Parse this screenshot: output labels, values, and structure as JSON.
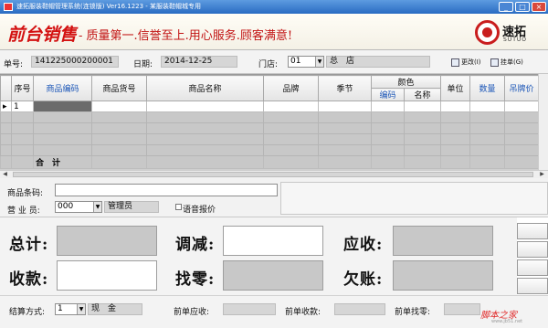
{
  "window": {
    "title": "速拓服装鞋帽管理系统(连锁版) Ver16.1223 - 某服装鞋帽城专用",
    "buttons": [
      "_",
      "□",
      "×"
    ]
  },
  "banner": {
    "brand": "前台销售",
    "slogan": "- 质量第一.信誉至上.用心服务.顾客满意!",
    "logo_cn": "速拓",
    "logo_en": "SUTUO",
    "logo_color": "#c91d1d"
  },
  "header": {
    "order_label": "单号:",
    "order_value": "141225000200001",
    "date_label": "日期:",
    "date_value": "2014-12-25",
    "store_label": "门店:",
    "store_code": "01",
    "store_name": "总　店",
    "tool1_label": "更改(I)",
    "tool2_label": "挂单(G)",
    "tool1_icon": "edit-icon",
    "tool2_icon": "hold-icon"
  },
  "grid": {
    "columns": [
      "序号",
      "商品编码",
      "商品货号",
      "商品名称",
      "品牌",
      "季节",
      "颜色",
      "单位",
      "数量",
      "吊牌价"
    ],
    "color_subcolumns": [
      "编码",
      "名称"
    ],
    "rows": [
      {
        "index": "1"
      }
    ],
    "total_label": "合　计"
  },
  "entry": {
    "barcode_label": "商品条码:",
    "barcode_value": "",
    "sales_label": "营 业 员:",
    "sales_code": "000",
    "sales_name": "管理员",
    "voice_label": "语音报价"
  },
  "summary": {
    "total_label": "总计:",
    "adjust_label": "调减:",
    "receivable_label": "应收:",
    "received_label": "收款:",
    "change_label": "找零:",
    "owed_label": "欠账:"
  },
  "footer": {
    "pay_label": "结算方式:",
    "pay_code": "1",
    "pay_name": "现　金",
    "prev_receivable_label": "前单应收:",
    "prev_received_label": "前单收款:",
    "prev_change_label": "前单找零:"
  },
  "watermark": {
    "text": "脚本之家",
    "sub": "www.jb51.net"
  }
}
